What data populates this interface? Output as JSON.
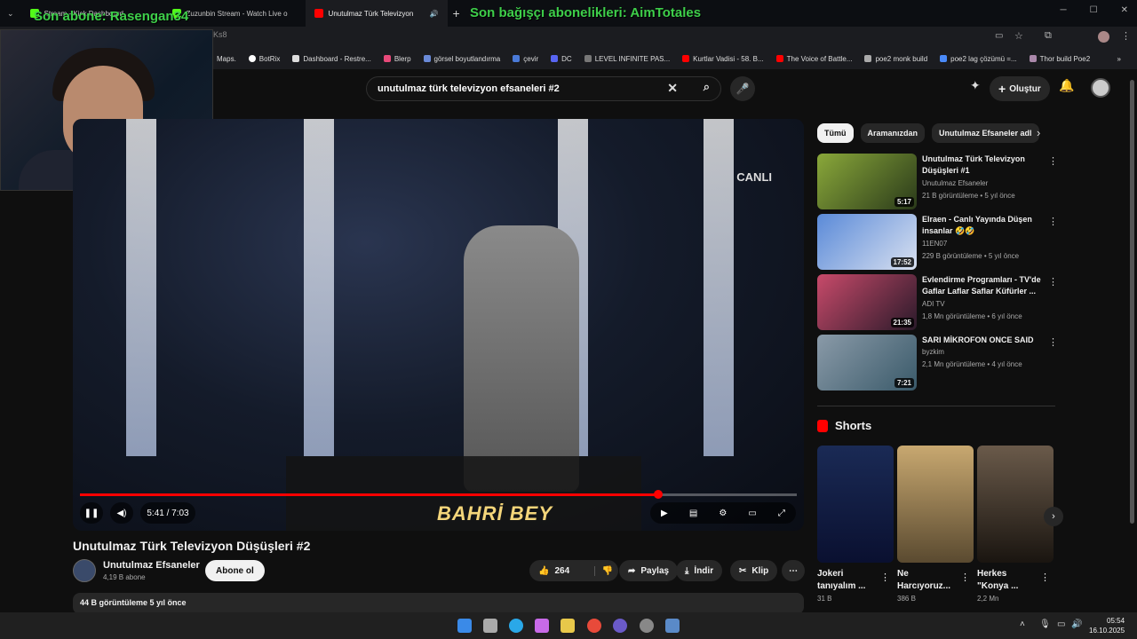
{
  "browser": {
    "tabs": [
      {
        "label": "Stream - Kick Dashboard",
        "icon": "kick-icon",
        "color": "#53fc18"
      },
      {
        "label": "Zuzunbin Stream - Watch Live o",
        "icon": "kick-icon",
        "color": "#53fc18"
      },
      {
        "label": "Unutulmaz Türk Televizyon",
        "icon": "youtube-icon",
        "color": "#ff0000"
      }
    ],
    "new_tab": "+",
    "url": "Ks8",
    "bookmarks": [
      "Maps.",
      "BotRix",
      "Dashboard - Restre...",
      "Blerp",
      "görsel boyutlandırma",
      "çevir",
      "DC",
      "LEVEL INFINITE PAS...",
      "Kurtlar Vadisi - 58. B...",
      "The Voice of Battle...",
      "poe2 monk build",
      "poe2 lag çözümü =...",
      "Thor build Poe2"
    ]
  },
  "overlay": {
    "last_sub": "Son abone: Rasengan34",
    "last_gift": "Son bağışçı abonelikleri: AimTotales"
  },
  "youtube": {
    "search_query": "unutulmaz türk televizyon efsaneleri #2",
    "create_label": "Oluştur",
    "player": {
      "time": "5:41 / 7:03",
      "progress": 0.807,
      "canli_label": "CANLI",
      "lower_third": "BAHRİ BEY"
    },
    "video_title": "Unutulmaz Türk Televizyon Düşüşleri #2",
    "channel": {
      "name": "Unutulmaz Efsaneler",
      "subs": "4,19 B abone",
      "subscribe": "Abone ol"
    },
    "actions": {
      "likes": "264",
      "share": "Paylaş",
      "download": "İndir",
      "clip": "Klip"
    },
    "description": "44 B görüntüleme  5 yıl önce",
    "chips": [
      "Tümü",
      "Aramanızdan",
      "Unutulmaz Efsaneler adl"
    ],
    "related": [
      {
        "title": "Unutulmaz Türk Televizyon Düşüşleri #1",
        "channel": "Unutulmaz Efsaneler",
        "meta": "21 B görüntüleme • 5 yıl önce",
        "duration": "5:17",
        "color": "#6b7a2a"
      },
      {
        "title": "Elraen - Canlı Yayında Düşen insanlar 🤣🤣",
        "channel": "11EN07",
        "meta": "229 B görüntüleme • 5 yıl önce",
        "duration": "17:52",
        "color": "#3a5aa8"
      },
      {
        "title": "Evlendirme Programları - TV'de Gaflar Laflar Saflar Küfürler ...",
        "channel": "ADI TV",
        "meta": "1,8 Mn görüntüleme • 6 yıl önce",
        "duration": "21:35",
        "color": "#7a2a3a"
      },
      {
        "title": "SARI MİKROFON ONCE SAID",
        "channel": "byzkim",
        "meta": "2,1 Mn görüntüleme • 4 yıl önce",
        "duration": "7:21",
        "color": "#5a7a8a"
      }
    ],
    "shorts_title": "Shorts",
    "shorts": [
      {
        "title": "Jokeri tanıyalım ...",
        "views": "31 B",
        "color": "#1a2a55"
      },
      {
        "title": "Ne Harcıyoruz...",
        "views": "386 B",
        "color": "#8a6a3a"
      },
      {
        "title": "Herkes \"Konya ...",
        "views": "2,2 Mn",
        "color": "#3a3530"
      }
    ]
  },
  "taskbar": {
    "time": "05:54",
    "date": "16.10.2025"
  }
}
